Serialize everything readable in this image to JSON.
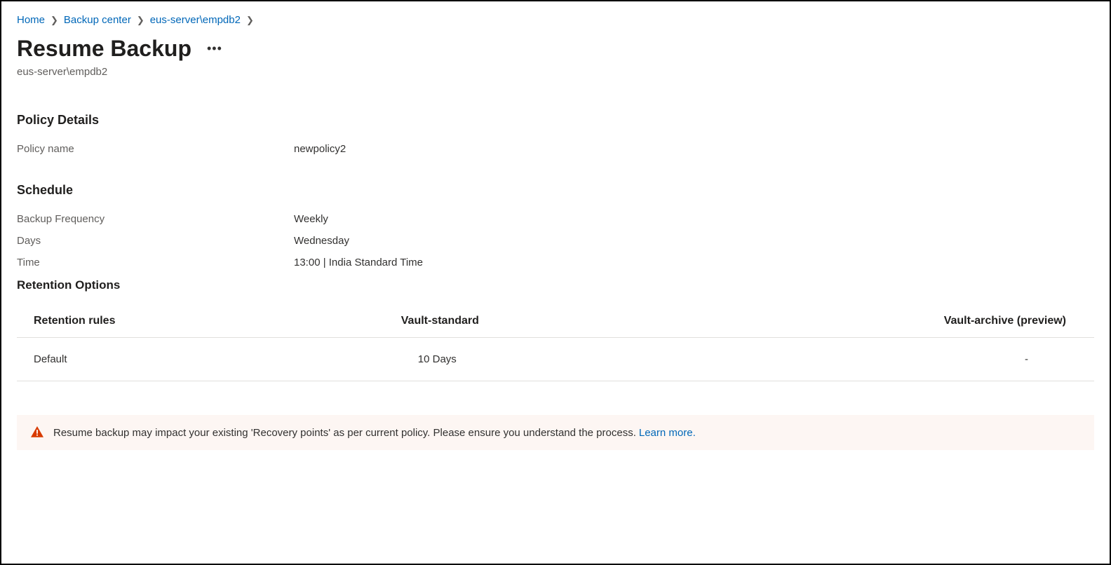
{
  "breadcrumb": {
    "items": [
      {
        "label": "Home"
      },
      {
        "label": "Backup center"
      },
      {
        "label": "eus-server\\empdb2"
      }
    ]
  },
  "header": {
    "title": "Resume Backup",
    "subtitle": "eus-server\\empdb2"
  },
  "policy_details": {
    "section_title": "Policy Details",
    "policy_name_label": "Policy name",
    "policy_name_value": "newpolicy2"
  },
  "schedule": {
    "section_title": "Schedule",
    "frequency_label": "Backup Frequency",
    "frequency_value": "Weekly",
    "days_label": "Days",
    "days_value": "Wednesday",
    "time_label": "Time",
    "time_value": "13:00 | India Standard Time"
  },
  "retention": {
    "section_title": "Retention Options",
    "columns": {
      "rules": "Retention rules",
      "vault_standard": "Vault-standard",
      "vault_archive": "Vault-archive (preview)"
    },
    "rows": [
      {
        "rule": "Default",
        "vault_standard": "10 Days",
        "vault_archive": "-"
      }
    ]
  },
  "warning": {
    "text": "Resume backup may impact your existing 'Recovery points' as per current policy. Please ensure you understand the process.",
    "link_label": "Learn more."
  }
}
